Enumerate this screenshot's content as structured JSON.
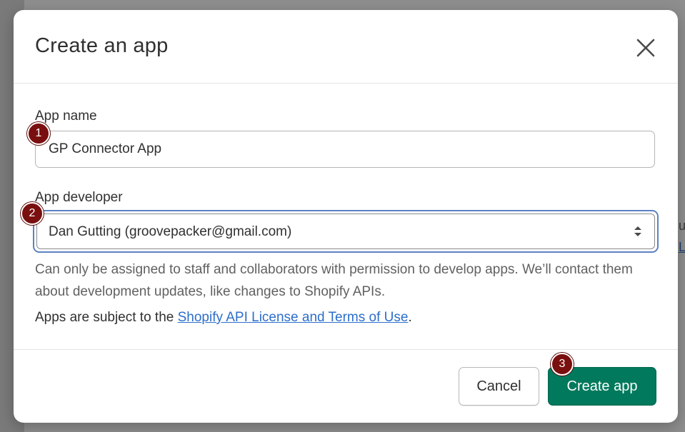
{
  "modal": {
    "title": "Create an app",
    "close_icon": "close-icon"
  },
  "form": {
    "app_name": {
      "label": "App name",
      "value": "GP Connector App"
    },
    "app_developer": {
      "label": "App developer",
      "selected": "Dan Gutting (groovepacker@gmail.com)",
      "help_text": "Can only be assigned to staff and collaborators with permission to develop apps. We’ll contact them about development updates, like changes to Shopify APIs."
    },
    "terms": {
      "prefix": "Apps are subject to the ",
      "link_text": "Shopify API License and Terms of Use",
      "suffix": "."
    }
  },
  "footer": {
    "cancel_label": "Cancel",
    "create_label": "Create app"
  },
  "steps": {
    "one": "1",
    "two": "2",
    "three": "3"
  },
  "background": {
    "fragment_1": "ui",
    "fragment_2": "Li"
  },
  "colors": {
    "primary_button": "#00795c",
    "link": "#2c6ecb",
    "focus_ring": "#5c82c4",
    "step_badge": "#7a0f0f"
  }
}
